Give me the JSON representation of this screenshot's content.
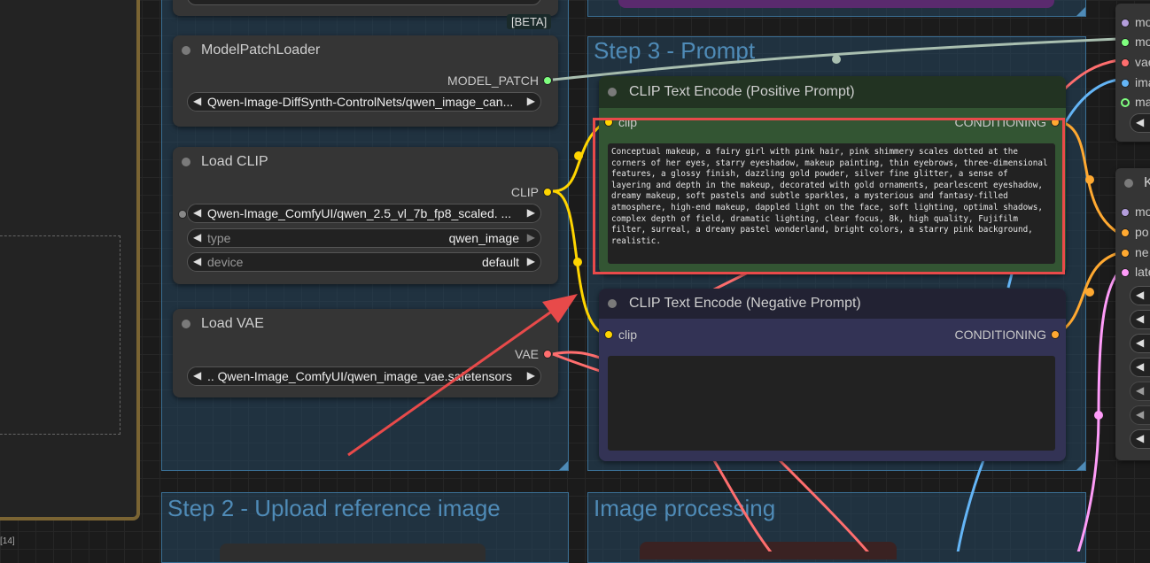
{
  "badge": "[BETA]",
  "footer_tag": "[14]",
  "groups": {
    "prompt": "Step 3 - Prompt",
    "upload": "Step 2 - Upload reference image",
    "processing": "Image processing"
  },
  "model_patch_loader": {
    "title": "ModelPatchLoader",
    "output": "MODEL_PATCH",
    "name_value": "Qwen-Image-DiffSynth-ControlNets/qwen_image_can..."
  },
  "load_clip": {
    "title": "Load CLIP",
    "output": "CLIP",
    "clip_name": "Qwen-Image_ComfyUI/qwen_2.5_vl_7b_fp8_scaled. ...",
    "type_label": "type",
    "type_value": "qwen_image",
    "device_label": "device",
    "device_value": "default"
  },
  "load_vae": {
    "title": "Load VAE",
    "output": "VAE",
    "vae_name": ".. Qwen-Image_ComfyUI/qwen_image_vae.safetensors"
  },
  "positive": {
    "title": "CLIP Text Encode (Positive Prompt)",
    "input": "clip",
    "output": "CONDITIONING",
    "text": "Conceptual makeup, a fairy girl with pink hair, pink shimmery scales dotted at the corners of her eyes, starry eyeshadow, makeup painting, thin eyebrows, three-dimensional features, a glossy finish, dazzling gold powder, silver fine glitter, a sense of layering and depth in the makeup, decorated with gold ornaments, pearlescent eyeshadow, dreamy makeup, soft pastels and subtle sparkles, a mysterious and fantasy-filled atmosphere, high-end makeup, dappled light on the face, soft lighting, optimal shadows, complex depth of field, dramatic lighting, clear focus, 8k, high quality, Fujifilm filter, surreal, a dreamy pastel wonderland, bright colors, a starry pink background, realistic."
  },
  "negative": {
    "title": "CLIP Text Encode (Negative Prompt)",
    "input": "clip",
    "output": "CONDITIONING",
    "text": ""
  },
  "right_node_a": {
    "slots": [
      "mo",
      "mo",
      "vae",
      "ima",
      "ma"
    ]
  },
  "right_node_b": {
    "title_initial": "K",
    "slots": [
      "mo",
      "po",
      "ne",
      "late"
    ]
  },
  "colors": {
    "clip": "#ffd500",
    "vae": "#ff6e6e",
    "model_patch": "#7fff7f",
    "conditioning": "#ffa931",
    "image": "#64b5f6",
    "latent": "#ff9cf9",
    "highlight": "#e84a4a"
  }
}
